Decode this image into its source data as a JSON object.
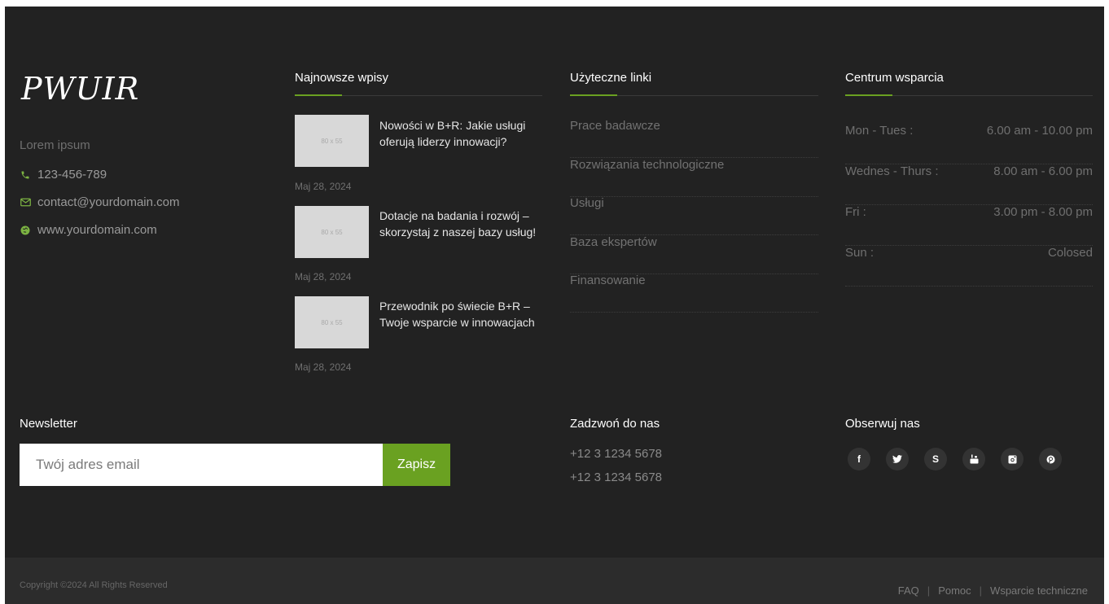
{
  "brand": {
    "logo": "PWUIR",
    "tagline": "Lorem ipsum",
    "phone": "123-456-789",
    "email": "contact@yourdomain.com",
    "website": "www.yourdomain.com",
    "accent_color": "#6aa121"
  },
  "latest_posts": {
    "title": "Najnowsze wpisy",
    "items": [
      {
        "thumb_label": "80 x 55",
        "title": "Nowości w B+R: Jakie usługi oferują liderzy innowacji?",
        "date": "Maj 28, 2024"
      },
      {
        "thumb_label": "80 x 55",
        "title": "Dotacje na badania i rozwój – skorzystaj z naszej bazy usług!",
        "date": "Maj 28, 2024"
      },
      {
        "thumb_label": "80 x 55",
        "title": "Przewodnik po świecie B+R – Twoje wsparcie w innowacjach",
        "date": "Maj 28, 2024"
      }
    ]
  },
  "useful_links": {
    "title": "Użyteczne linki",
    "items": [
      "Prace badawcze",
      "Rozwiązania technologiczne",
      "Usługi",
      "Baza ekspertów",
      "Finansowanie"
    ]
  },
  "support": {
    "title": "Centrum wsparcia",
    "hours": [
      {
        "day": "Mon - Tues :",
        "time": "6.00 am - 10.00 pm"
      },
      {
        "day": "Wednes - Thurs :",
        "time": "8.00 am - 6.00 pm"
      },
      {
        "day": "Fri :",
        "time": "3.00 pm - 8.00 pm"
      },
      {
        "day": "Sun :",
        "time": "Colosed"
      }
    ]
  },
  "newsletter": {
    "title": "Newsletter",
    "placeholder": "Twój adres email",
    "button": "Zapisz"
  },
  "call": {
    "title": "Zadzwoń do nas",
    "phones": [
      "+12 3 1234 5678",
      "+12 3 1234 5678"
    ]
  },
  "follow": {
    "title": "Obserwuj nas",
    "icons": [
      "facebook-icon",
      "twitter-icon",
      "skype-icon",
      "youtube-icon",
      "instagram-icon",
      "pinterest-icon"
    ]
  },
  "bottom": {
    "copyright": "Copyright ©2024 All Rights Reserved",
    "links": [
      "FAQ",
      "Pomoc",
      "Wsparcie techniczne"
    ]
  }
}
